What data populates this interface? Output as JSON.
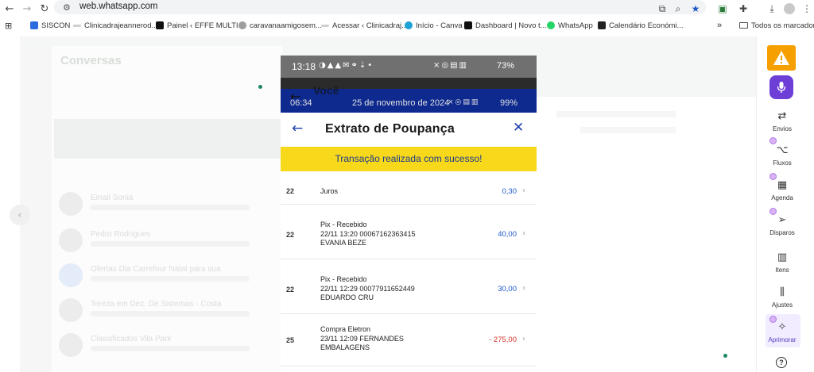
{
  "browser": {
    "url": "web.whatsapp.com",
    "bookmarks": [
      {
        "label": "SISCON",
        "color": "#2d6cdf"
      },
      {
        "label": "Clinicadrajeannerod...",
        "color": "#bdbdbd"
      },
      {
        "label": "Painel ‹ EFFE MULTI...",
        "color": "#111111"
      },
      {
        "label": "caravanaamigosem...",
        "color": "#9e9e9e"
      },
      {
        "label": "Acessar ‹ Clinicadraj...",
        "color": "#bdbdbd"
      },
      {
        "label": "Início - Canva",
        "color": "#1fa3d6"
      },
      {
        "label": "Dashboard | Novo t...",
        "color": "#111111"
      },
      {
        "label": "WhatsApp",
        "color": "#25d366"
      },
      {
        "label": "Calendário Económi...",
        "color": "#222222"
      },
      {
        "label": "Todos os marcadores",
        "color": "#555555"
      }
    ],
    "overflow_label": "»"
  },
  "whatsapp": {
    "title": "Conversas",
    "chats": [
      {
        "name": "Email Sonia"
      },
      {
        "name": "Pedro Rodrigues"
      },
      {
        "name": "Ofertas Dia Carrefour Natal para sua"
      },
      {
        "name": "Tereza em Dez. De Sistemas - Costa"
      },
      {
        "name": "Classificados Vila Park"
      }
    ]
  },
  "sidebar": {
    "items": [
      {
        "label": "Envios",
        "icon": "refresh-icon"
      },
      {
        "label": "Fluxos",
        "icon": "flow-icon"
      },
      {
        "label": "Agenda",
        "icon": "calendar-icon"
      },
      {
        "label": "Disparos",
        "icon": "send-icon"
      },
      {
        "label": "Itens",
        "icon": "bars-icon"
      },
      {
        "label": "Ajustes",
        "icon": "sliders-icon"
      },
      {
        "label": "Aprimorar",
        "icon": "magic-wand-icon"
      }
    ],
    "accent": "#f5a000",
    "mic_color": "#6e3fd6"
  },
  "phone": {
    "status_time": "13:18",
    "status_battery": "73%",
    "contact_name": "Você",
    "inner_time": "06:34",
    "inner_date": "25 de novembro de 2024",
    "inner_battery": "99%",
    "screen_title": "Extrato de Poupança",
    "success_message": "Transação realizada com sucesso!",
    "transactions": [
      {
        "day": "22",
        "lines": [
          "Juros"
        ],
        "amount": "0,30",
        "negative": false
      },
      {
        "day": "22",
        "lines": [
          "Pix - Recebido",
          "22/11 13:20 00067162363415",
          "EVANIA BEZE"
        ],
        "amount": "40,00",
        "negative": false
      },
      {
        "day": "22",
        "lines": [
          "Pix - Recebido",
          "22/11 12:29 00077911652449",
          "EDUARDO CRU"
        ],
        "amount": "30,00",
        "negative": false
      },
      {
        "day": "25",
        "lines": [
          "Compra Eletron",
          "23/11 12:09 FERNANDES",
          "EMBALAGENS"
        ],
        "amount": "- 275,00",
        "negative": true
      }
    ],
    "brand_blue": "#1d3fb0",
    "success_yellow": "#f8d81b"
  }
}
